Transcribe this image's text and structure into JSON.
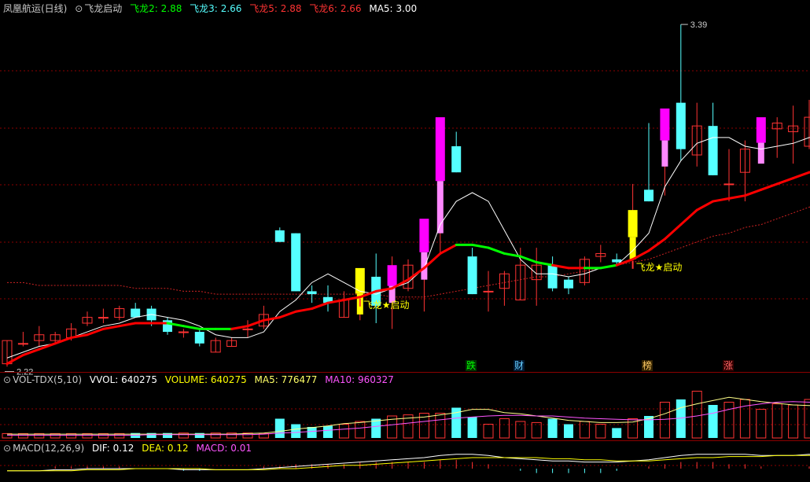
{
  "header": {
    "stock": "凤凰航运(日线)",
    "indicator": "飞龙启动",
    "fl2_label": "飞龙2:",
    "fl2_value": "2.88",
    "fl3_label": "飞龙3:",
    "fl3_value": "2.66",
    "fl5_label": "飞龙5:",
    "fl5_value": "2.88",
    "fl6_label": "飞龙6:",
    "fl6_value": "2.66",
    "ma5_label": "MA5:",
    "ma5_value": "3.00"
  },
  "vol_header": {
    "name": "VOL-TDX(5,10)",
    "vvol_label": "VVOL:",
    "vvol_value": "640275",
    "volume_label": "VOLUME:",
    "volume_value": "640275",
    "ma5_label": "MA5:",
    "ma5_value": "776477",
    "ma10_label": "MA10:",
    "ma10_value": "960327"
  },
  "macd_header": {
    "name": "MACD(12,26,9)",
    "dif_label": "DIF:",
    "dif_value": "0.12",
    "dea_label": "DEA:",
    "dea_value": "0.12",
    "macd_label": "MACD:",
    "macd_value": "0.01"
  },
  "annotations": {
    "high_label": "3.39",
    "low_label": "2.22",
    "signal_text_1": "飞龙★启动",
    "signal_text_2": "飞龙★启动"
  },
  "events": [
    {
      "label": "跌",
      "color": "#00ff00",
      "bg": "#003300"
    },
    {
      "label": "财",
      "color": "#66ccff",
      "bg": "#001a33"
    },
    {
      "label": "榜",
      "color": "#ffcc66",
      "bg": "#332200"
    },
    {
      "label": "涨",
      "color": "#ff6666",
      "bg": "#330000"
    }
  ],
  "colors": {
    "up": "#ff3333",
    "down": "#55ffff",
    "ma": "#ffffff",
    "fl_red": "#ff0000",
    "fl_green": "#00ff00",
    "magenta": "#ff00ff",
    "yellow": "#ffff00",
    "pink": "#ff88ff",
    "grid": "#8b0000"
  },
  "chart_data": {
    "type": "candlestick",
    "price_min": 2.2,
    "price_max": 3.42,
    "candles": [
      {
        "o": 2.22,
        "h": 2.3,
        "l": 2.21,
        "c": 2.3
      },
      {
        "o": 2.29,
        "h": 2.33,
        "l": 2.28,
        "c": 2.29
      },
      {
        "o": 2.3,
        "h": 2.35,
        "l": 2.28,
        "c": 2.32
      },
      {
        "o": 2.3,
        "h": 2.33,
        "l": 2.29,
        "c": 2.32
      },
      {
        "o": 2.31,
        "h": 2.36,
        "l": 2.3,
        "c": 2.34
      },
      {
        "o": 2.36,
        "h": 2.4,
        "l": 2.35,
        "c": 2.38
      },
      {
        "o": 2.38,
        "h": 2.41,
        "l": 2.36,
        "c": 2.38
      },
      {
        "o": 2.38,
        "h": 2.42,
        "l": 2.37,
        "c": 2.41
      },
      {
        "o": 2.41,
        "h": 2.43,
        "l": 2.38,
        "c": 2.38
      },
      {
        "o": 2.41,
        "h": 2.42,
        "l": 2.35,
        "c": 2.37
      },
      {
        "o": 2.37,
        "h": 2.38,
        "l": 2.32,
        "c": 2.33
      },
      {
        "o": 2.33,
        "h": 2.34,
        "l": 2.31,
        "c": 2.33
      },
      {
        "o": 2.33,
        "h": 2.34,
        "l": 2.28,
        "c": 2.29
      },
      {
        "o": 2.26,
        "h": 2.31,
        "l": 2.26,
        "c": 2.3
      },
      {
        "o": 2.28,
        "h": 2.31,
        "l": 2.28,
        "c": 2.3
      },
      {
        "o": 2.34,
        "h": 2.37,
        "l": 2.31,
        "c": 2.34
      },
      {
        "o": 2.35,
        "h": 2.42,
        "l": 2.34,
        "c": 2.39
      },
      {
        "o": 2.68,
        "h": 2.69,
        "l": 2.64,
        "c": 2.64
      },
      {
        "o": 2.67,
        "h": 2.67,
        "l": 2.47,
        "c": 2.47
      },
      {
        "o": 2.47,
        "h": 2.49,
        "l": 2.43,
        "c": 2.46
      },
      {
        "o": 2.45,
        "h": 2.49,
        "l": 2.4,
        "c": 2.43
      },
      {
        "o": 2.38,
        "h": 2.47,
        "l": 2.38,
        "c": 2.44
      },
      {
        "o": 2.39,
        "h": 2.49,
        "l": 2.37,
        "c": 2.55,
        "sig": "y"
      },
      {
        "o": 2.52,
        "h": 2.6,
        "l": 2.36,
        "c": 2.42
      },
      {
        "o": 2.43,
        "h": 2.59,
        "l": 2.34,
        "c": 2.56,
        "sig": "m"
      },
      {
        "o": 2.48,
        "h": 2.58,
        "l": 2.47,
        "c": 2.56
      },
      {
        "o": 2.51,
        "h": 2.6,
        "l": 2.4,
        "c": 2.72,
        "sig": "m"
      },
      {
        "o": 2.67,
        "h": 3.0,
        "l": 2.6,
        "c": 3.07,
        "sig": "m"
      },
      {
        "o": 2.97,
        "h": 3.02,
        "l": 2.88,
        "c": 2.88
      },
      {
        "o": 2.59,
        "h": 2.62,
        "l": 2.46,
        "c": 2.46
      },
      {
        "o": 2.47,
        "h": 2.54,
        "l": 2.4,
        "c": 2.47
      },
      {
        "o": 2.48,
        "h": 2.54,
        "l": 2.42,
        "c": 2.53
      },
      {
        "o": 2.44,
        "h": 2.62,
        "l": 2.44,
        "c": 2.56
      },
      {
        "o": 2.51,
        "h": 2.62,
        "l": 2.42,
        "c": 2.56
      },
      {
        "o": 2.56,
        "h": 2.59,
        "l": 2.47,
        "c": 2.48
      },
      {
        "o": 2.51,
        "h": 2.52,
        "l": 2.46,
        "c": 2.48
      },
      {
        "o": 2.5,
        "h": 2.59,
        "l": 2.49,
        "c": 2.58
      },
      {
        "o": 2.59,
        "h": 2.63,
        "l": 2.57,
        "c": 2.6
      },
      {
        "o": 2.58,
        "h": 2.6,
        "l": 2.56,
        "c": 2.57
      },
      {
        "o": 2.58,
        "h": 2.84,
        "l": 2.58,
        "c": 2.75,
        "sig": "y"
      },
      {
        "o": 2.82,
        "h": 3.05,
        "l": 2.78,
        "c": 2.78
      },
      {
        "o": 2.9,
        "h": 3.09,
        "l": 2.8,
        "c": 3.1,
        "sig": "m"
      },
      {
        "o": 3.12,
        "h": 3.39,
        "l": 2.92,
        "c": 2.96
      },
      {
        "o": 2.94,
        "h": 3.12,
        "l": 2.9,
        "c": 3.04
      },
      {
        "o": 3.04,
        "h": 3.12,
        "l": 2.87,
        "c": 2.87
      },
      {
        "o": 2.84,
        "h": 2.96,
        "l": 2.78,
        "c": 2.84
      },
      {
        "o": 2.88,
        "h": 2.99,
        "l": 2.78,
        "c": 2.96
      },
      {
        "o": 2.91,
        "h": 3.04,
        "l": 2.92,
        "c": 3.07,
        "sig": "m"
      },
      {
        "o": 3.03,
        "h": 3.07,
        "l": 2.93,
        "c": 3.05
      },
      {
        "o": 3.02,
        "h": 3.11,
        "l": 2.91,
        "c": 3.04
      },
      {
        "o": 2.97,
        "h": 3.13,
        "l": 2.96,
        "c": 3.07
      },
      {
        "o": 2.97,
        "h": 3.04,
        "l": 2.89,
        "c": 2.94
      }
    ],
    "ma5": [
      2.24,
      2.26,
      2.28,
      2.29,
      2.31,
      2.33,
      2.35,
      2.36,
      2.38,
      2.39,
      2.38,
      2.37,
      2.35,
      2.32,
      2.31,
      2.31,
      2.33,
      2.4,
      2.44,
      2.5,
      2.53,
      2.5,
      2.47,
      2.46,
      2.48,
      2.5,
      2.55,
      2.7,
      2.78,
      2.81,
      2.78,
      2.68,
      2.58,
      2.53,
      2.53,
      2.52,
      2.53,
      2.55,
      2.56,
      2.61,
      2.67,
      2.83,
      2.92,
      2.98,
      3.0,
      3.0,
      2.97,
      2.96,
      2.97,
      2.98,
      3.0,
      3.0
    ],
    "feilong": [
      2.22,
      2.25,
      2.27,
      2.29,
      2.31,
      2.32,
      2.34,
      2.35,
      2.36,
      2.36,
      2.36,
      2.35,
      2.34,
      2.34,
      2.34,
      2.35,
      2.37,
      2.38,
      2.4,
      2.41,
      2.43,
      2.44,
      2.45,
      2.47,
      2.48,
      2.51,
      2.55,
      2.6,
      2.63,
      2.63,
      2.62,
      2.6,
      2.59,
      2.57,
      2.56,
      2.55,
      2.55,
      2.55,
      2.56,
      2.58,
      2.61,
      2.65,
      2.7,
      2.75,
      2.78,
      2.79,
      2.8,
      2.82,
      2.84,
      2.86,
      2.88,
      2.88
    ],
    "feilong_trend": [
      "r",
      "r",
      "r",
      "r",
      "r",
      "r",
      "r",
      "r",
      "r",
      "r",
      "r",
      "g",
      "g",
      "g",
      "g",
      "r",
      "r",
      "r",
      "r",
      "r",
      "r",
      "r",
      "r",
      "r",
      "r",
      "r",
      "r",
      "r",
      "r",
      "g",
      "g",
      "g",
      "g",
      "g",
      "g",
      "r",
      "r",
      "g",
      "g",
      "r",
      "r",
      "r",
      "r",
      "r",
      "r",
      "r",
      "r",
      "r",
      "r",
      "r",
      "r",
      "r"
    ],
    "slow": [
      2.5,
      2.5,
      2.49,
      2.49,
      2.49,
      2.49,
      2.49,
      2.49,
      2.48,
      2.48,
      2.48,
      2.47,
      2.47,
      2.46,
      2.46,
      2.46,
      2.46,
      2.46,
      2.46,
      2.46,
      2.46,
      2.46,
      2.46,
      2.46,
      2.45,
      2.45,
      2.45,
      2.46,
      2.47,
      2.48,
      2.49,
      2.5,
      2.51,
      2.52,
      2.52,
      2.53,
      2.54,
      2.55,
      2.56,
      2.57,
      2.58,
      2.6,
      2.62,
      2.64,
      2.66,
      2.67,
      2.69,
      2.7,
      2.72,
      2.74,
      2.76,
      2.78
    ],
    "volume": [
      0.08,
      0.08,
      0.08,
      0.08,
      0.08,
      0.08,
      0.08,
      0.08,
      0.09,
      0.09,
      0.09,
      0.09,
      0.09,
      0.09,
      0.09,
      0.09,
      0.08,
      0.35,
      0.25,
      0.2,
      0.22,
      0.25,
      0.3,
      0.35,
      0.4,
      0.42,
      0.45,
      0.45,
      0.55,
      0.38,
      0.25,
      0.35,
      0.3,
      0.28,
      0.35,
      0.25,
      0.3,
      0.25,
      0.18,
      0.35,
      0.4,
      0.65,
      0.7,
      0.85,
      0.6,
      0.65,
      0.7,
      0.52,
      0.62,
      0.6,
      0.7,
      0.48
    ],
    "vol_ma5": [
      0.07,
      0.07,
      0.07,
      0.07,
      0.07,
      0.07,
      0.07,
      0.07,
      0.07,
      0.07,
      0.07,
      0.07,
      0.07,
      0.07,
      0.07,
      0.08,
      0.09,
      0.12,
      0.16,
      0.19,
      0.22,
      0.26,
      0.28,
      0.31,
      0.34,
      0.36,
      0.38,
      0.42,
      0.46,
      0.52,
      0.52,
      0.46,
      0.44,
      0.4,
      0.36,
      0.32,
      0.3,
      0.28,
      0.28,
      0.29,
      0.35,
      0.44,
      0.55,
      0.62,
      0.68,
      0.74,
      0.7,
      0.66,
      0.63,
      0.6,
      0.59,
      0.58
    ],
    "vol_ma10": [
      0.05,
      0.05,
      0.05,
      0.05,
      0.05,
      0.05,
      0.05,
      0.05,
      0.05,
      0.06,
      0.06,
      0.06,
      0.06,
      0.06,
      0.06,
      0.06,
      0.07,
      0.09,
      0.1,
      0.12,
      0.14,
      0.16,
      0.18,
      0.21,
      0.24,
      0.27,
      0.3,
      0.33,
      0.36,
      0.38,
      0.4,
      0.41,
      0.41,
      0.4,
      0.4,
      0.38,
      0.36,
      0.35,
      0.34,
      0.33,
      0.33,
      0.34,
      0.36,
      0.4,
      0.45,
      0.52,
      0.58,
      0.62,
      0.65,
      0.66,
      0.65,
      0.65
    ],
    "dif": [
      -0.02,
      -0.02,
      -0.02,
      -0.01,
      -0.01,
      0.0,
      0.0,
      0.0,
      0.0,
      0.0,
      0.0,
      -0.01,
      -0.01,
      -0.01,
      -0.01,
      -0.01,
      0.0,
      0.01,
      0.02,
      0.03,
      0.04,
      0.05,
      0.06,
      0.07,
      0.08,
      0.09,
      0.1,
      0.12,
      0.13,
      0.13,
      0.12,
      0.1,
      0.09,
      0.08,
      0.07,
      0.07,
      0.06,
      0.06,
      0.06,
      0.07,
      0.08,
      0.1,
      0.12,
      0.13,
      0.13,
      0.13,
      0.13,
      0.12,
      0.12,
      0.12,
      0.13,
      0.12
    ],
    "dea": [
      -0.02,
      -0.02,
      -0.02,
      -0.02,
      -0.02,
      -0.01,
      -0.01,
      -0.01,
      0.0,
      0.0,
      0.0,
      0.0,
      0.0,
      -0.01,
      -0.01,
      -0.01,
      -0.01,
      0.0,
      0.0,
      0.01,
      0.02,
      0.03,
      0.03,
      0.04,
      0.05,
      0.06,
      0.07,
      0.08,
      0.09,
      0.1,
      0.1,
      0.1,
      0.1,
      0.1,
      0.09,
      0.09,
      0.08,
      0.08,
      0.07,
      0.07,
      0.07,
      0.08,
      0.09,
      0.1,
      0.1,
      0.11,
      0.11,
      0.11,
      0.12,
      0.12,
      0.12,
      0.12
    ]
  }
}
